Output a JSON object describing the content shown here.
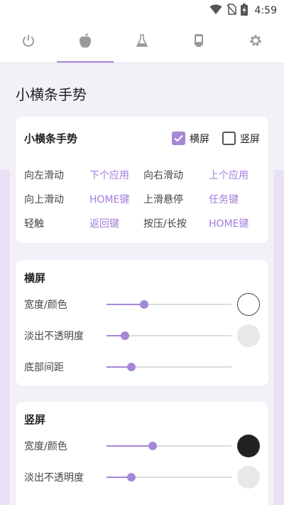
{
  "status_bar": {
    "time": "4:59",
    "icons": [
      "wifi-icon",
      "no-sim-icon",
      "battery-charging-icon"
    ]
  },
  "tabs": [
    {
      "icon": "power-icon",
      "active": false
    },
    {
      "icon": "apple-icon",
      "active": true
    },
    {
      "icon": "flask-icon",
      "active": false
    },
    {
      "icon": "phone-icon",
      "active": false
    },
    {
      "icon": "gear-icon",
      "active": false
    }
  ],
  "colors": {
    "accent": "#a487d8",
    "link": "#a07ddc",
    "background": "#f3f1f7"
  },
  "page": {
    "title": "小横条手势"
  },
  "gesture_card": {
    "title": "小横条手势",
    "landscape_label": "横屏",
    "landscape_checked": true,
    "portrait_label": "竖屏",
    "portrait_checked": false,
    "rows": [
      [
        {
          "label": "向左滑动",
          "value": "下个应用"
        },
        {
          "label": "向右滑动",
          "value": "上个应用"
        }
      ],
      [
        {
          "label": "向上滑动",
          "value": "HOME键"
        },
        {
          "label": "上滑悬停",
          "value": "任务键"
        }
      ],
      [
        {
          "label": "轻触",
          "value": "返回键"
        },
        {
          "label": "按压/长按",
          "value": "HOME键"
        }
      ]
    ]
  },
  "landscape": {
    "title": "横屏",
    "rows": [
      {
        "label": "宽度/颜色",
        "slider_fraction": 0.3,
        "swatch": "white"
      },
      {
        "label": "淡出不透明度",
        "slider_fraction": 0.15,
        "swatch": "grey"
      },
      {
        "label": "底部间距",
        "slider_fraction": 0.2,
        "swatch": "none"
      }
    ]
  },
  "portrait": {
    "title": "竖屏",
    "rows": [
      {
        "label": "宽度/颜色",
        "slider_fraction": 0.37,
        "swatch": "black"
      },
      {
        "label": "淡出不透明度",
        "slider_fraction": 0.2,
        "swatch": "grey"
      }
    ]
  }
}
